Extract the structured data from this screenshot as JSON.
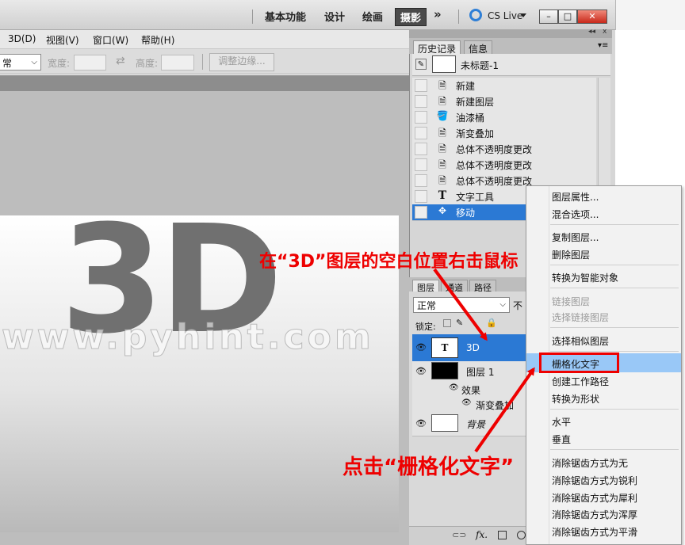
{
  "titlebar": {
    "workspaces": [
      "基本功能",
      "设计",
      "绘画",
      "摄影"
    ],
    "active_workspace": "摄影",
    "more_label": "»",
    "cslive_label": "CS Live",
    "min_label": "–",
    "max_label": "□",
    "close_label": "✕"
  },
  "menubar": {
    "items": [
      "3D(D)",
      "视图(V)",
      "窗口(W)",
      "帮助(H)"
    ]
  },
  "options": {
    "style_value": "常",
    "width_label": "宽度:",
    "swap_icon": "⇄",
    "height_label": "高度:",
    "refine_button": "调整边缘..."
  },
  "canvas": {
    "text": "3D"
  },
  "history": {
    "tabs": [
      "历史记录",
      "信息"
    ],
    "snapshot_name": "未标题-1",
    "rows": [
      {
        "label": "新建",
        "icon": "document-icon"
      },
      {
        "label": "新建图层",
        "icon": "document-icon"
      },
      {
        "label": "油漆桶",
        "icon": "paint-bucket-icon"
      },
      {
        "label": "渐变叠加",
        "icon": "document-icon"
      },
      {
        "label": "总体不透明度更改",
        "icon": "document-icon"
      },
      {
        "label": "总体不透明度更改",
        "icon": "document-icon"
      },
      {
        "label": "总体不透明度更改",
        "icon": "document-icon"
      },
      {
        "label": "文字工具",
        "icon": "type-icon"
      },
      {
        "label": "移动",
        "icon": "move-icon"
      }
    ]
  },
  "layers": {
    "tabs": [
      "图层",
      "通道",
      "路径"
    ],
    "blend_mode": "正常",
    "opacity_label": "不",
    "lock_label": "锁定:",
    "rows": {
      "text_layer": "3D",
      "layer1": "图层 1",
      "effects": "效果",
      "gradient": "渐变叠加",
      "background": "背景"
    },
    "text_thumb": "T",
    "fx_label": "fx."
  },
  "context_menu": {
    "items": [
      "图层属性...",
      "混合选项...",
      "复制图层...",
      "删除图层",
      "转换为智能对象",
      "链接图层",
      "选择链接图层",
      "选择相似图层",
      "栅格化文字",
      "创建工作路径",
      "转换为形状",
      "水平",
      "垂直",
      "消除锯齿方式为无",
      "消除锯齿方式为锐利",
      "消除锯齿方式为犀利",
      "消除锯齿方式为浑厚",
      "消除锯齿方式为平滑"
    ],
    "highlighted": "栅格化文字"
  },
  "annotations": {
    "top": "在“3D”图层的空白位置右击鼠标",
    "bottom": "点击“栅格化文字”"
  },
  "watermark": "www.pyhint.com",
  "colors": {
    "selection_blue": "#2b79d4",
    "annotation_red": "#ee0000",
    "menu_highlight": "#99c8f7"
  }
}
